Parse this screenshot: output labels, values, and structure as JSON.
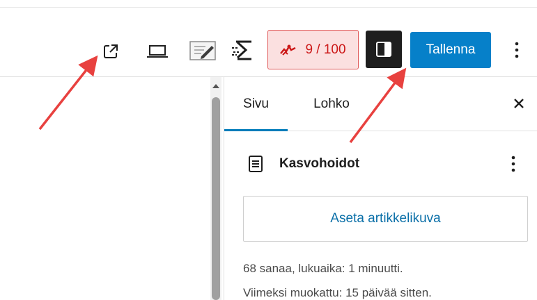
{
  "toolbar": {
    "seo_score": "9 / 100",
    "save_label": "Tallenna",
    "icons": [
      "external-link-icon",
      "desktop-preview-icon",
      "edit-note-icon",
      "performance-icon",
      "seo-logo-icon",
      "sidebar-toggle-icon",
      "more-options-icon"
    ]
  },
  "sidebar": {
    "tabs": [
      {
        "label": "Sivu",
        "active": true
      },
      {
        "label": "Lohko",
        "active": false
      }
    ],
    "document": {
      "title": "Kasvohoidot",
      "featured_image_button": "Aseta artikkelikuva",
      "stats": "68 sanaa, lukuaika: 1 minuutti.",
      "last_modified": "Viimeksi muokattu: 15 päivää sitten."
    }
  },
  "colors": {
    "accent_blue": "#0680c9",
    "seo_bad_red": "#cc1818",
    "seo_bad_bg": "#fbe0e0",
    "annotation_arrow": "#e8413f"
  }
}
